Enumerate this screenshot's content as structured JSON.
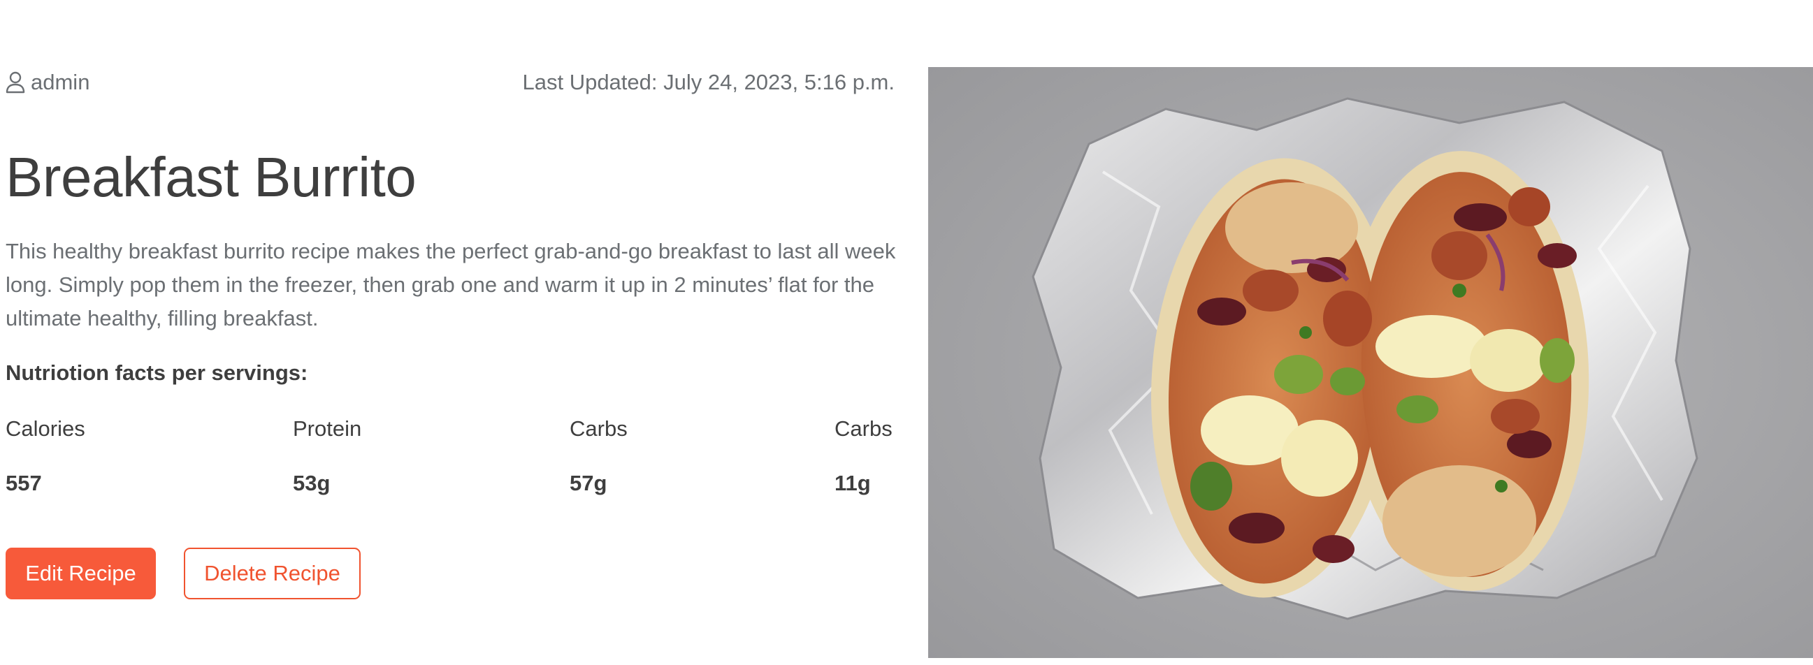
{
  "recipe": {
    "author": "admin",
    "last_updated": "Last Updated: July 24, 2023, 5:16 p.m.",
    "title": "Breakfast Burrito",
    "description": "This healthy breakfast burrito recipe makes the perfect grab-and-go breakfast to last all week long. Simply pop them in the freezer, then grab one and warm it up in 2 minutes’ flat for the ultimate healthy, filling breakfast.",
    "image_icon": "burrito-photo"
  },
  "nutrition": {
    "heading": "Nutriotion facts per servings:",
    "facts": [
      {
        "label": "Calories",
        "value": "557"
      },
      {
        "label": "Protein",
        "value": "53g"
      },
      {
        "label": "Carbs",
        "value": "57g"
      },
      {
        "label": "Carbs",
        "value": "11g"
      }
    ]
  },
  "actions": {
    "edit_label": "Edit Recipe",
    "delete_label": "Delete Recipe"
  },
  "colors": {
    "accent": "#f75a3a",
    "muted_text": "#6b6f73",
    "heading_text": "#3e3e3e"
  }
}
